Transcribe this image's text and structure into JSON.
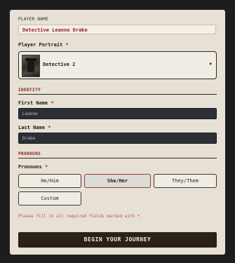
{
  "player_name": {
    "label": "PLAYER NAME",
    "value": "Detective Leanne Drake"
  },
  "portrait": {
    "label": "Player Portrait",
    "required_mark": "*",
    "selected": "Detective 2"
  },
  "identity": {
    "section_title": "IDENTITY",
    "first_name": {
      "label": "First Name",
      "required_mark": "*",
      "value": "Leanne"
    },
    "last_name": {
      "label": "Last Name",
      "required_mark": "*",
      "value": "Drake"
    }
  },
  "pronouns": {
    "section_title": "PRONOUNS",
    "label": "Pronouns",
    "required_mark": "*",
    "options": [
      "He/Him",
      "She/Her",
      "They/Them",
      "Custom"
    ],
    "selected": "She/Her"
  },
  "error_message": "Please fill in all required fields marked with *.",
  "submit_label": "BEGIN YOUR JOURNEY",
  "colors": {
    "card_bg": "#e6e1d4",
    "accent_red": "#8b1a1a",
    "dark_input": "#2c2f36",
    "submit_bg": "#2b2118"
  }
}
